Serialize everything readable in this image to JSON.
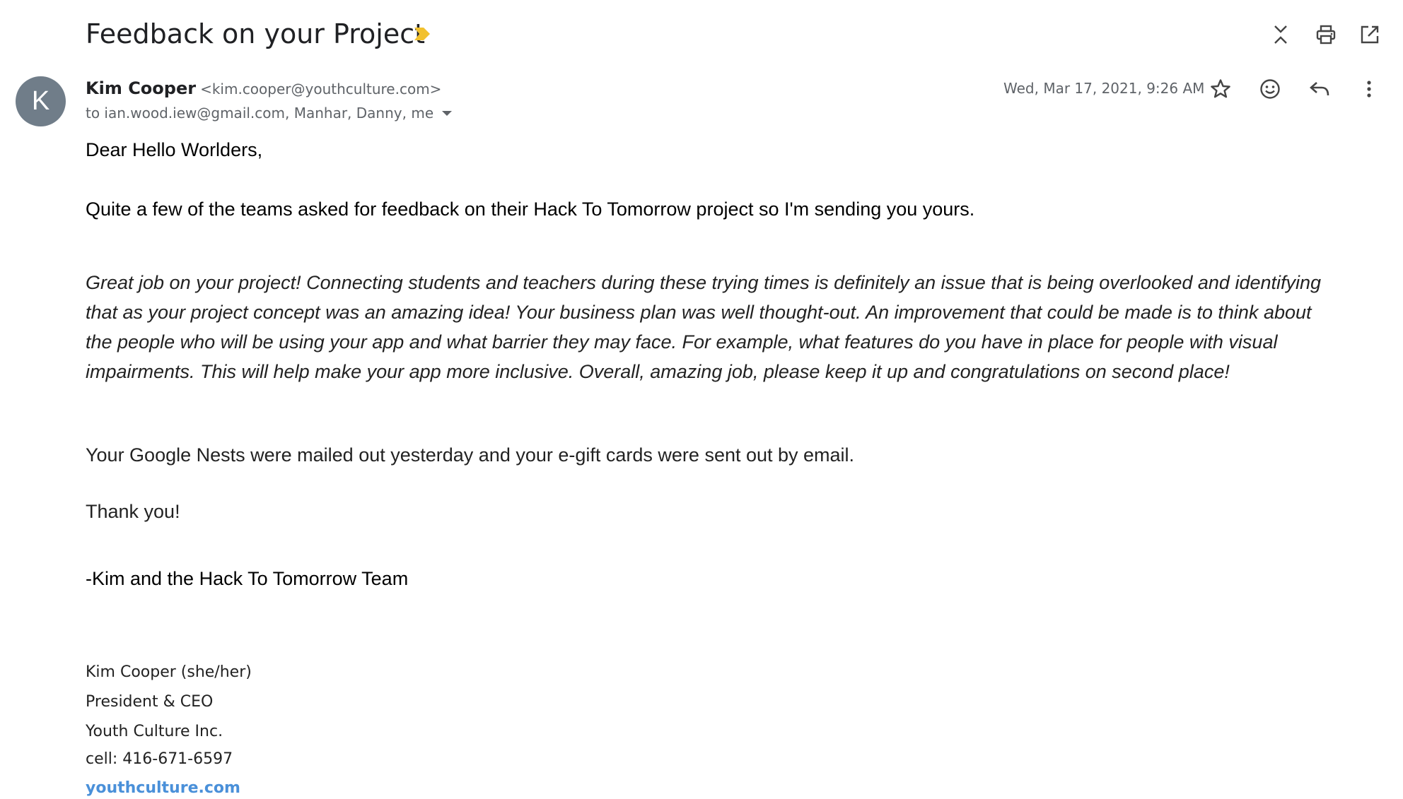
{
  "email": {
    "subject": "Feedback on your Project",
    "sender": {
      "avatar_letter": "K",
      "name": "Kim Cooper",
      "email": "<kim.cooper@youthculture.com>"
    },
    "recipients": "to ian.wood.iew@gmail.com, Manhar, Danny, me",
    "timestamp": "Wed, Mar 17, 2021, 9:26 AM",
    "body": {
      "greeting": "Dear Hello Worlders,",
      "intro": "Quite a few of the teams asked for feedback on their Hack To Tomorrow project so I'm sending you yours.",
      "feedback_lines": [
        "Great job on your project! Connecting students and teachers during these trying times is definitely an issue that is being overlooked and identifying",
        "that as your project concept was an amazing idea! Your business plan was well thought-out. An improvement that could be made is to think about",
        "the people who will be using your app and what barrier they may face. For example, what features do you have in place for people with visual",
        "impairments. This will help make your app more inclusive. Overall, amazing job, please keep it up and congratulations on second place!"
      ],
      "shipping": "Your Google Nests were mailed out yesterday and your e-gift cards were sent out by email.",
      "thanks": "Thank you!",
      "signoff": "-Kim and the Hack To Tomorrow Team"
    },
    "signature": {
      "name": "Kim Cooper (she/her)",
      "title": "President & CEO",
      "company": "Youth Culture Inc.",
      "cell": "cell: 416-671-6597",
      "website": "youthculture.com"
    }
  },
  "icons": {
    "importance": "importance-marker-icon",
    "collapse": "collapse-all-icon",
    "print": "print-icon",
    "open_new_window": "open-in-new-window-icon",
    "star": "star-icon",
    "emoji": "emoji-reaction-icon",
    "reply": "reply-icon",
    "more": "more-vertical-icon"
  },
  "colors": {
    "avatar_bg": "#707d89",
    "importance_marker": "#f2c12e",
    "link": "#4a90d9",
    "secondary_text": "#5f6368"
  }
}
